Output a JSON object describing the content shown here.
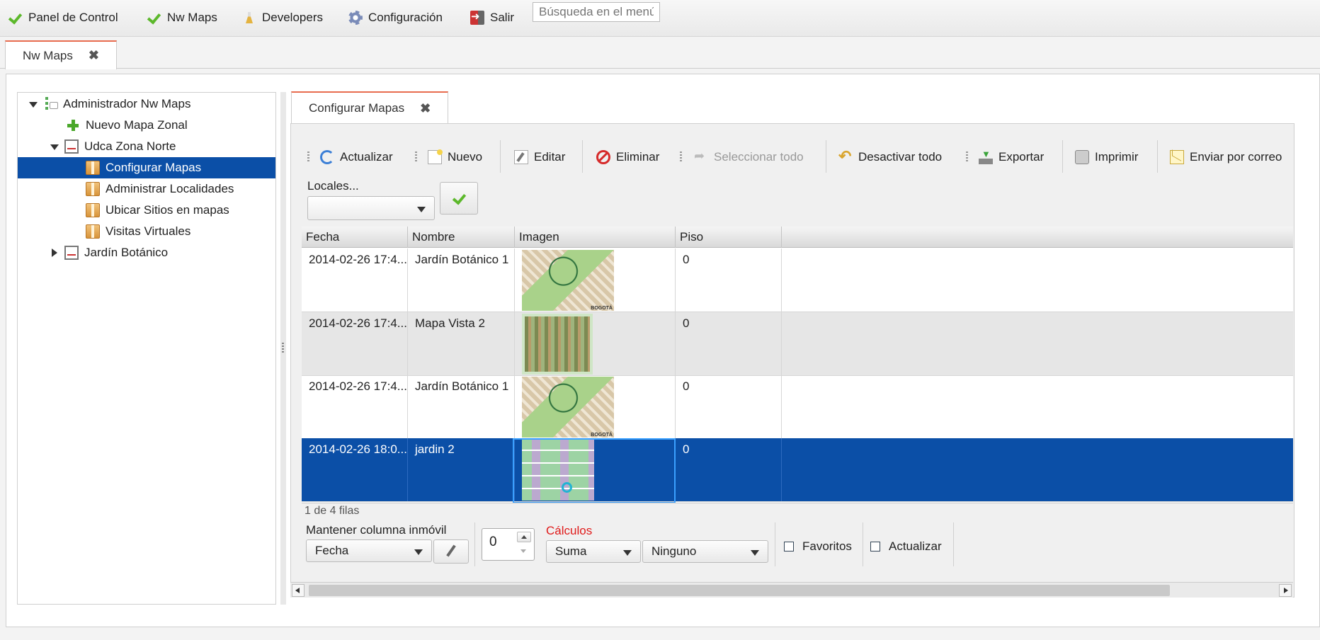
{
  "top_menu": {
    "items": [
      {
        "label": "Panel de Control",
        "icon": "check-icon"
      },
      {
        "label": "Nw Maps",
        "icon": "check-icon"
      },
      {
        "label": "Developers",
        "icon": "flask-icon"
      },
      {
        "label": "Configuración",
        "icon": "gear-icon"
      },
      {
        "label": "Salir",
        "icon": "exit-icon"
      }
    ],
    "search_placeholder": "Búsqueda en el menú"
  },
  "outer_tab": {
    "label": "Nw Maps",
    "close": "✖"
  },
  "tree": {
    "items": [
      {
        "label": "Administrador Nw Maps",
        "icon": "tree-root-icon",
        "expanded": true
      },
      {
        "label": "Nuevo Mapa Zonal",
        "icon": "plus-icon"
      },
      {
        "label": "Udca Zona Norte",
        "icon": "board-icon",
        "expanded": true
      },
      {
        "label": "Configurar Mapas",
        "icon": "box-icon",
        "selected": true
      },
      {
        "label": "Administrar Localidades",
        "icon": "box-icon"
      },
      {
        "label": "Ubicar Sitios en mapas",
        "icon": "box-icon"
      },
      {
        "label": "Visitas Virtuales",
        "icon": "box-icon"
      },
      {
        "label": "Jardín Botánico",
        "icon": "board-icon",
        "expanded": false
      }
    ]
  },
  "inner_tab": {
    "label": "Configurar Mapas",
    "close": "✖"
  },
  "toolbar": {
    "refresh": "Actualizar",
    "new": "Nuevo",
    "edit": "Editar",
    "delete": "Eliminar",
    "select_all": "Seleccionar todo",
    "deactivate_all": "Desactivar todo",
    "export": "Exportar",
    "print": "Imprimir",
    "email": "Enviar por correo"
  },
  "filter": {
    "label": "Locales...",
    "value": ""
  },
  "grid": {
    "columns": [
      "Fecha",
      "Nombre",
      "Imagen",
      "Piso"
    ],
    "rows": [
      {
        "fecha": "2014-02-26 17:4...",
        "nombre": "Jardín Botánico 1",
        "piso": "0"
      },
      {
        "fecha": "2014-02-26 17:4...",
        "nombre": "Mapa Vista 2",
        "piso": "0"
      },
      {
        "fecha": "2014-02-26 17:4...",
        "nombre": "Jardín Botánico 1",
        "piso": "0"
      },
      {
        "fecha": "2014-02-26 18:0...",
        "nombre": "jardin 2",
        "piso": "0"
      }
    ],
    "pager": "1 de 4 filas"
  },
  "footer": {
    "freeze_label": "Mantener columna inmóvil",
    "freeze_value": "Fecha",
    "stepper_value": "0",
    "calc_label": "Cálculos",
    "calc_func": "Suma",
    "calc_target": "Ninguno",
    "favorites": "Favoritos",
    "refresh": "Actualizar"
  },
  "colors": {
    "selection": "#0b4fa7",
    "tab_accent": "#e86c4f",
    "calc_label": "#e01b1b"
  }
}
